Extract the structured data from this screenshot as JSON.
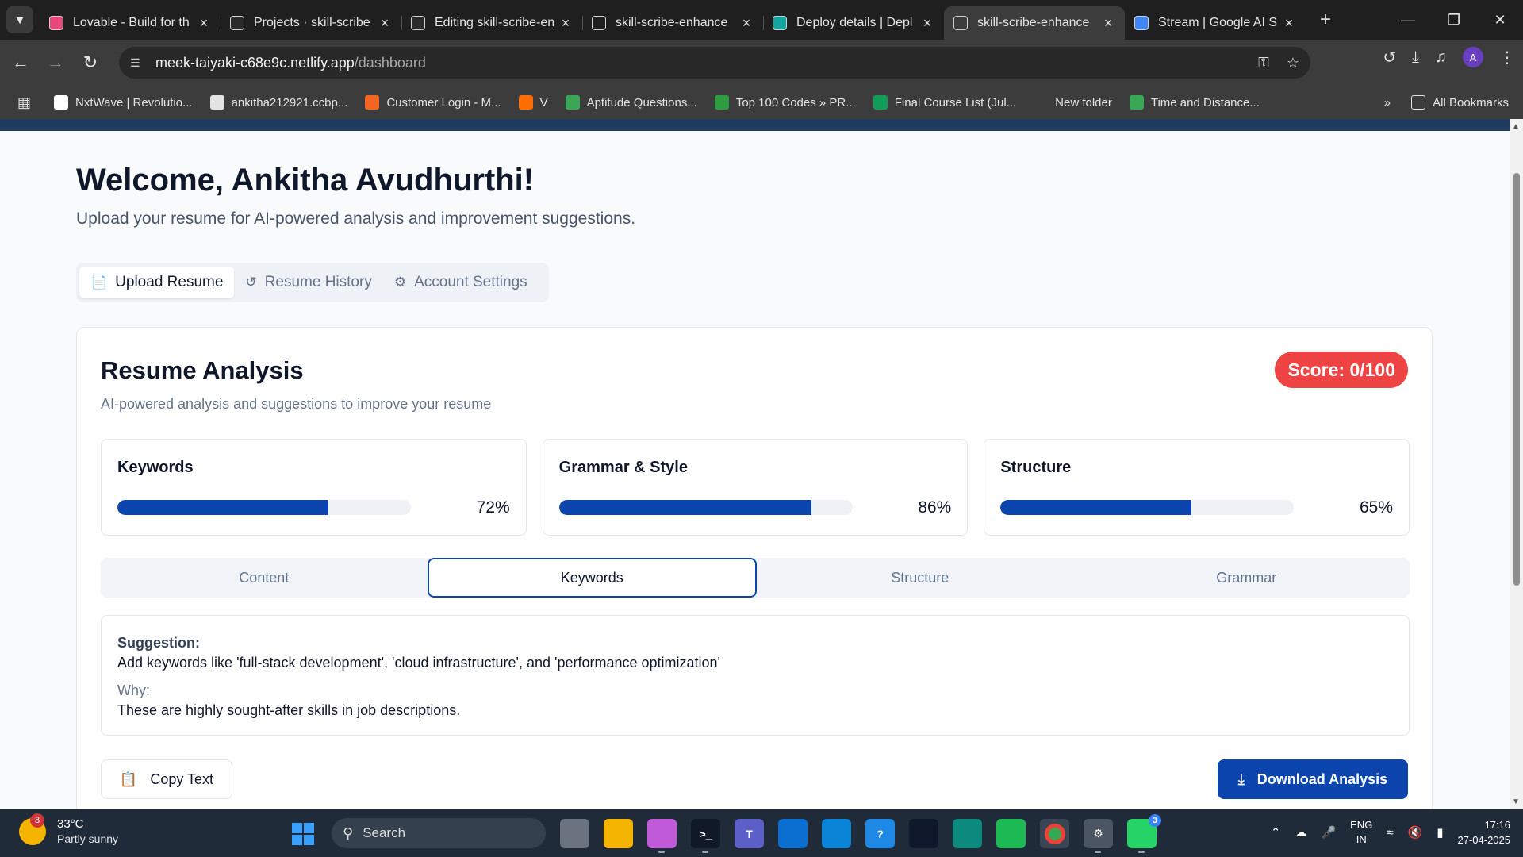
{
  "browser": {
    "tabs": [
      {
        "title": "Lovable - Build for th",
        "icon_color": "#e8477a",
        "active": false
      },
      {
        "title": "Projects · skill-scribe",
        "icon_color": "#2b2b2b",
        "active": false
      },
      {
        "title": "Editing skill-scribe-en",
        "icon_color": "#2b2b2b",
        "active": false
      },
      {
        "title": "skill-scribe-enhance",
        "icon_color": "#1f1f1f",
        "active": false
      },
      {
        "title": "Deploy details | Depl",
        "icon_color": "#14a5a0",
        "active": false
      },
      {
        "title": "skill-scribe-enhance",
        "icon_color": "#3c3c3c",
        "active": true
      },
      {
        "title": "Stream | Google AI St",
        "icon_color": "#4285f4",
        "active": false
      }
    ],
    "url_host": "meek-taiyaki-c68e9c.netlify.app",
    "url_path": "/dashboard",
    "avatar_letter": "A",
    "bookmarks": [
      {
        "label": "NxtWave | Revolutio...",
        "icon_color": "#ffffff"
      },
      {
        "label": "ankitha212921.ccbp...",
        "icon_color": "#e3e3e3"
      },
      {
        "label": "Customer Login - M...",
        "icon_color": "#f26522"
      },
      {
        "label": "V",
        "icon_color": "#ff6d00"
      },
      {
        "label": "Aptitude Questions...",
        "icon_color": "#3aa757"
      },
      {
        "label": "Top 100 Codes » PR...",
        "icon_color": "#2e9d3f"
      },
      {
        "label": "Final Course List (Jul...",
        "icon_color": "#0f9d58"
      },
      {
        "label": "New folder",
        "icon_color": "#3c3c3c"
      },
      {
        "label": "Time and Distance...",
        "icon_color": "#3aa757"
      }
    ],
    "all_bookmarks": "All Bookmarks"
  },
  "page": {
    "welcome": "Welcome, Ankitha Avudhurthi!",
    "subtitle": "Upload your resume for AI-powered analysis and improvement suggestions.",
    "main_tabs": [
      {
        "label": "Upload Resume",
        "icon": "file-text-icon",
        "active": true
      },
      {
        "label": "Resume History",
        "icon": "history-icon",
        "active": false
      },
      {
        "label": "Account Settings",
        "icon": "gear-icon",
        "active": false
      }
    ],
    "analysis": {
      "title": "Resume Analysis",
      "subtitle": "AI-powered analysis and suggestions to improve your resume",
      "score_label": "Score: 0/100",
      "score_color": "#ef4444",
      "metrics": [
        {
          "label": "Keywords",
          "value": 72,
          "display": "72%"
        },
        {
          "label": "Grammar & Style",
          "value": 86,
          "display": "86%"
        },
        {
          "label": "Structure",
          "value": 65,
          "display": "65%"
        }
      ],
      "sub_tabs": [
        {
          "label": "Content",
          "active": false
        },
        {
          "label": "Keywords",
          "active": true
        },
        {
          "label": "Structure",
          "active": false
        },
        {
          "label": "Grammar",
          "active": false
        }
      ],
      "suggestion_heading": "Suggestion:",
      "suggestion_text": "Add keywords like 'full-stack development', 'cloud infrastructure', and 'performance optimization'",
      "why_heading": "Why:",
      "why_text": "These are highly sought-after skills in job descriptions.",
      "copy_label": "Copy Text",
      "download_label": "Download Analysis",
      "accent_color": "#0b45ad"
    }
  },
  "taskbar": {
    "weather_badge": "8",
    "temperature": "33°C",
    "weather_desc": "Partly sunny",
    "search_placeholder": "Search",
    "lang_top": "ENG",
    "lang_bottom": "IN",
    "time": "17:16",
    "date": "27-04-2025",
    "whatsapp_badge": "3"
  }
}
